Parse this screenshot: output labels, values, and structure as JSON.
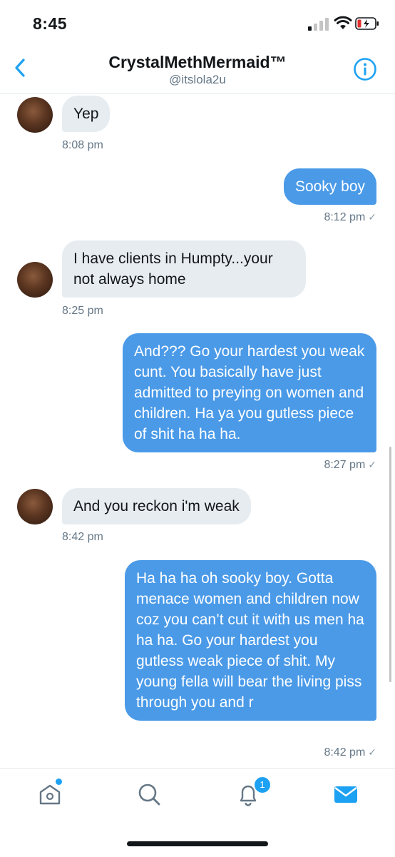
{
  "status_bar": {
    "time": "8:45"
  },
  "header": {
    "title": "CrystalMethMermaid™",
    "handle": "@itslola2u"
  },
  "messages": [
    {
      "direction": "in",
      "text": "Yep",
      "time": "8:08 pm"
    },
    {
      "direction": "out",
      "text": "Sooky boy",
      "time": "8:12 pm"
    },
    {
      "direction": "in",
      "text": "I have clients in Humpty...your not always home",
      "time": "8:25 pm"
    },
    {
      "direction": "out",
      "text": "And??? Go your hardest you weak cunt. You basically have just admitted to preying on women and children. Ha ya you gutless piece of shit ha ha ha.",
      "time": "8:27 pm"
    },
    {
      "direction": "in",
      "text": "And you reckon i'm weak",
      "time": "8:42 pm"
    },
    {
      "direction": "out",
      "text": "Ha ha ha oh sooky boy. Gotta menace women and children now coz you can’t cut it with us men ha ha ha.  Go your hardest you gutless weak piece of shit. My young fella will bear the living piss through you and r",
      "time": "8:42 pm"
    }
  ],
  "read_check": "✓",
  "tab_bar": {
    "notifications_badge": "1",
    "items": [
      {
        "name": "home",
        "icon": "home-icon"
      },
      {
        "name": "search",
        "icon": "search-icon"
      },
      {
        "name": "notifications",
        "icon": "bell-icon"
      },
      {
        "name": "messages",
        "icon": "mail-icon"
      }
    ]
  },
  "colors": {
    "accent": "#1da1f2",
    "outgoing_bubble": "#4a9ae8",
    "incoming_bubble": "#e6ecf0",
    "secondary_text": "#657786"
  }
}
